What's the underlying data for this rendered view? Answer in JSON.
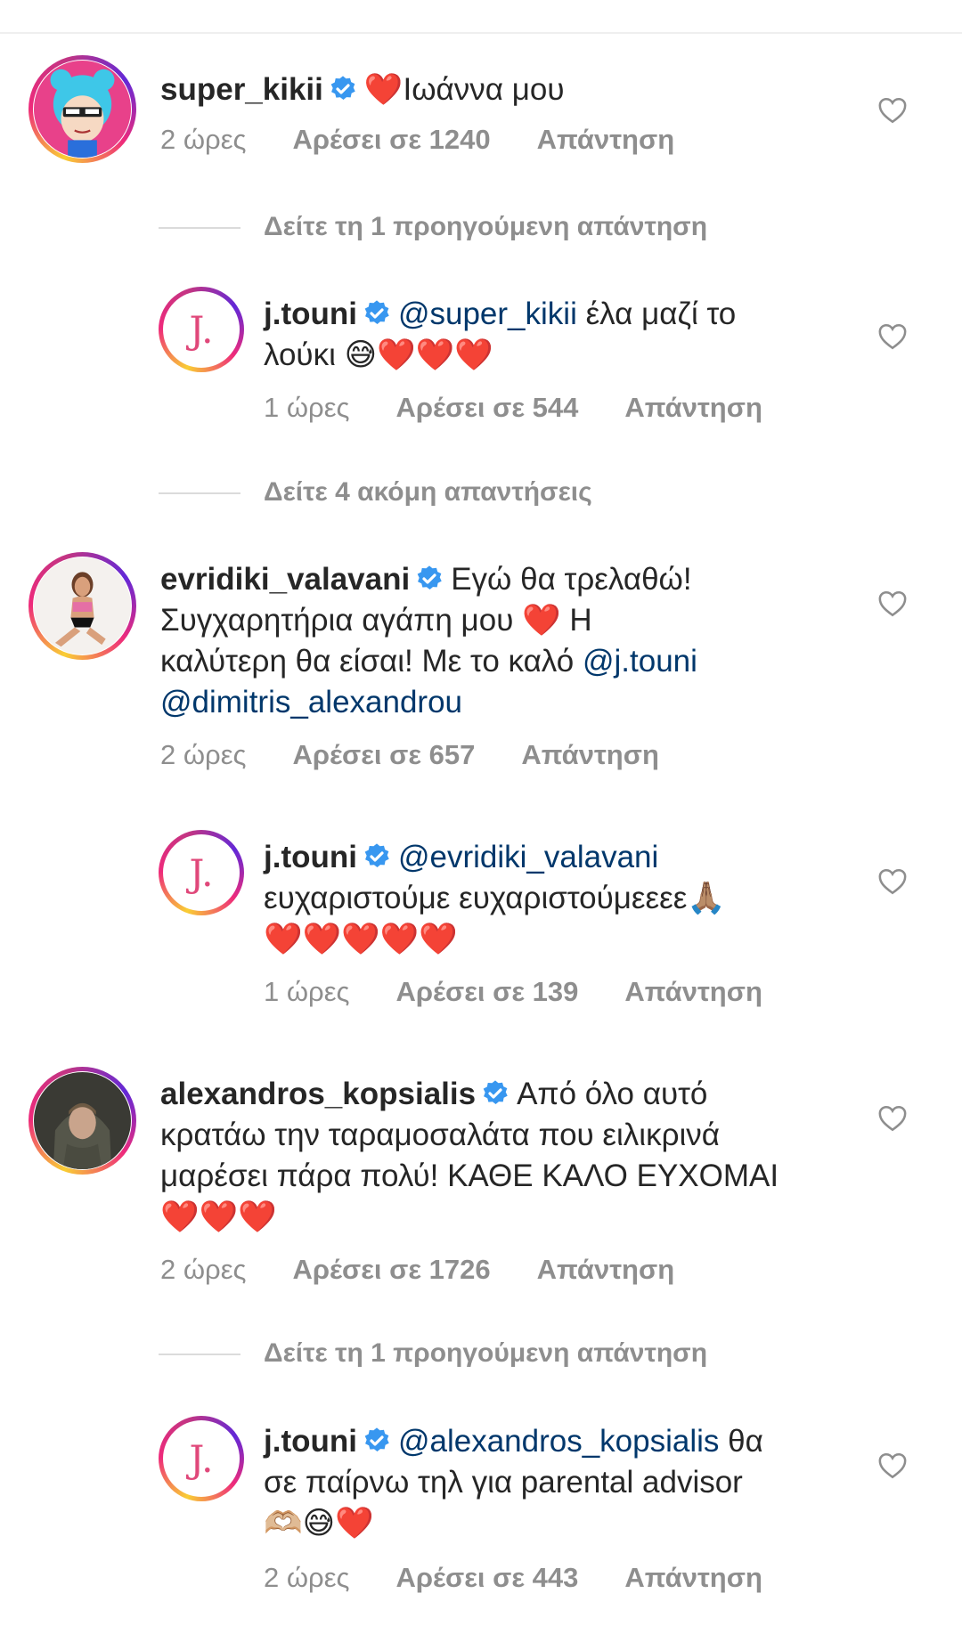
{
  "comments": [
    {
      "username": "super_kikii",
      "text": "❤️Ιωάννα μου",
      "time": "2 ώρες",
      "likes": "Αρέσει σε 1240",
      "reply": "Απάντηση",
      "view_replies": "Δείτε τη 1 προηγούμενη απάντηση"
    },
    {
      "username": "j.touni",
      "mention": "@super_kikii",
      "text_line1": "έλα μαζί το",
      "text_line2": "λούκι 😅❤️❤️❤️",
      "time": "1 ώρες",
      "likes": "Αρέσει σε 544",
      "reply": "Απάντηση",
      "view_replies": "Δείτε 4 ακόμη απαντήσεις"
    },
    {
      "username": "evridiki_valavani",
      "text_line1": "Εγώ θα τρελαθώ!",
      "text_line2": "Συγχαρητήρια αγάπη μου ❤️ Η",
      "text_line3": "καλύτερη θα είσαι! Με το καλό",
      "mention1": "@j.touni",
      "mention2": "@dimitris_alexandrou",
      "time": "2 ώρες",
      "likes": "Αρέσει σε 657",
      "reply": "Απάντηση"
    },
    {
      "username": "j.touni",
      "mention": "@evridiki_valavani",
      "text_line2": "ευχαριστούμε ευχαριστούμεεεε🙏🏽",
      "text_line3": "❤️❤️❤️❤️❤️",
      "time": "1 ώρες",
      "likes": "Αρέσει σε 139",
      "reply": "Απάντηση"
    },
    {
      "username": "alexandros_kopsialis",
      "text_line1": "Από όλο αυτό",
      "text_line2": "κρατάω την ταραμοσαλάτα που ειλικρινά",
      "text_line3": "μαρέσει πάρα πολύ! ΚΑΘΕ ΚΑΛΟ ΕΥΧΟΜΑΙ",
      "text_line4": "❤️❤️❤️",
      "time": "2 ώρες",
      "likes": "Αρέσει σε 1726",
      "reply": "Απάντηση",
      "view_replies": "Δείτε τη 1 προηγούμενη απάντηση"
    },
    {
      "username": "j.touni",
      "mention": "@alexandros_kopsialis",
      "text_line1": "θα",
      "text_line2": "σε παίρνω τηλ για parental advisor",
      "text_line3": "🫶🏼😅❤️",
      "time": "2 ώρες",
      "likes": "Αρέσει σε 443",
      "reply": "Απάντηση"
    }
  ],
  "avatar_logo_text": "J.",
  "colors": {
    "text": "#262626",
    "meta": "#8e8e8e",
    "mention": "#00376b",
    "verified": "#3897f0",
    "heart": "#e41e3f"
  }
}
